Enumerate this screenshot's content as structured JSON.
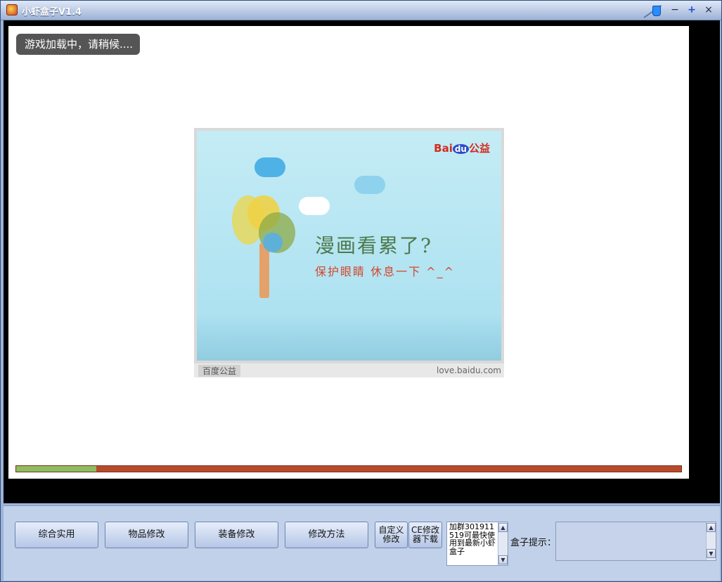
{
  "window": {
    "title": "小虾盒子V1.4",
    "controls": {
      "minimize": "−",
      "maximize": "+",
      "close": "×"
    }
  },
  "game": {
    "loading_text": "游戏加载中，请稍候....",
    "progress": 0.12
  },
  "ad": {
    "brand": "Bai",
    "brand_du": "du",
    "brand_suffix": "公益",
    "headline": "漫画看累了?",
    "subline": "保护眼睛  休息一下 ^_^",
    "footer_logo": "百度公益",
    "footer_url": "love.baidu.com"
  },
  "toolbar": {
    "btn1": "综合实用",
    "btn2": "物品修改",
    "btn3": "装备修改",
    "btn4": "修改方法",
    "btn5_line1": "自定义",
    "btn5_line2": "修改",
    "btn6_line1": "CE修改",
    "btn6_line2": "器下载"
  },
  "notice": {
    "text": "加群301911519可最快使用到最新小虾盒子"
  },
  "hint": {
    "label": "盒子提示："
  }
}
